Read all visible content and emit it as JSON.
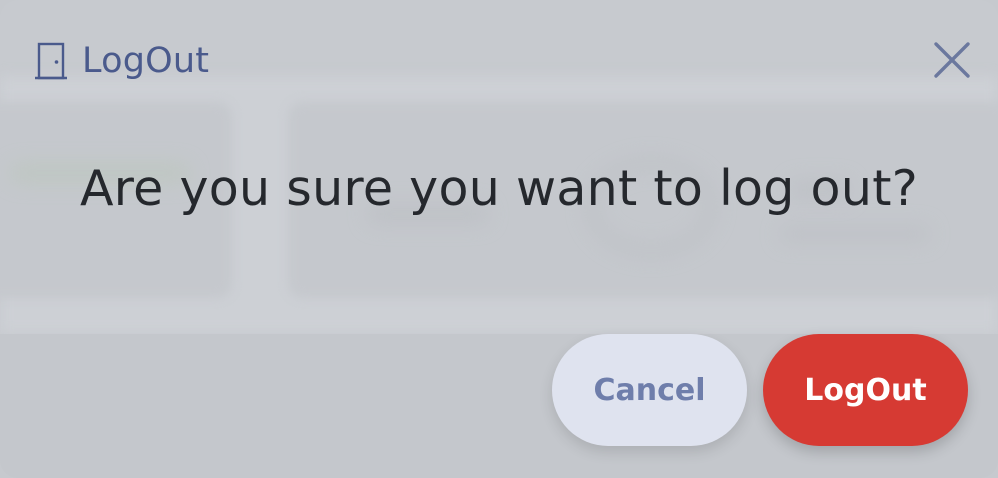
{
  "dialog": {
    "title": "LogOut",
    "header_icon": "door-icon",
    "close_icon": "close-icon",
    "message": "Are you sure you want to log out?",
    "cancel_label": "Cancel",
    "confirm_label": "LogOut"
  },
  "colors": {
    "title": "#4a5a8c",
    "message": "#25282d",
    "cancel_bg": "#dfe3ef",
    "cancel_text": "#6f7eab",
    "confirm_bg": "#d63a33",
    "confirm_text": "#ffffff",
    "overlay": "#c7cacf"
  }
}
